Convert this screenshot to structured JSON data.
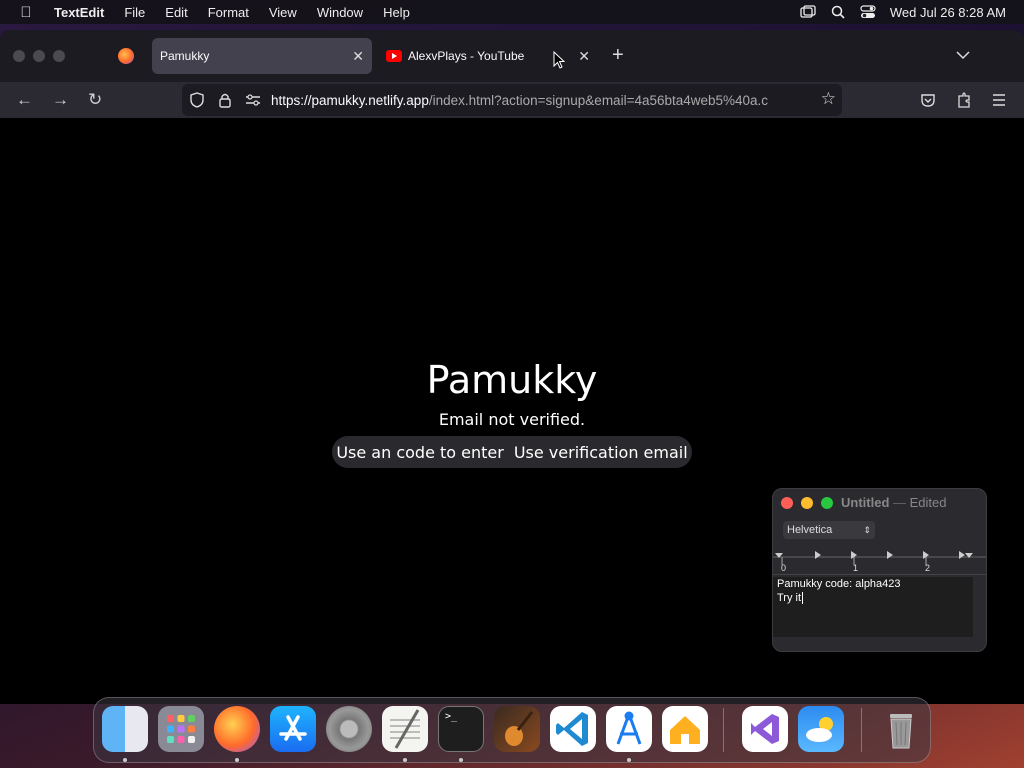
{
  "menubar": {
    "app_name": "TextEdit",
    "items": [
      "File",
      "Edit",
      "Format",
      "View",
      "Window",
      "Help"
    ],
    "clock": "Wed Jul 26  8:28 AM"
  },
  "browser": {
    "tabs": [
      {
        "title": "Pamukky",
        "active": true
      },
      {
        "title": "AlexvPlays - YouTube",
        "active": false
      }
    ],
    "url_host": "https://pamukky.netlify.app",
    "url_path": "/index.html?action=signup&email=4a56bta4web5%40a.c"
  },
  "page": {
    "title": "Pamukky",
    "subtitle": "Email not verified.",
    "code_button": "Use an code to enter",
    "email_button": "Use verification email"
  },
  "textedit": {
    "title": "Untitled",
    "status": "Edited",
    "font": "Helvetica",
    "ruler_marks": [
      "0",
      "1",
      "2"
    ],
    "lines": [
      "Pamukky code: alpha423",
      "Try it"
    ]
  },
  "dock": {
    "apps": [
      "Finder",
      "Launchpad",
      "Firefox",
      "App Store",
      "System Settings",
      "TextEdit",
      "Terminal",
      "GarageBand",
      "Visual Studio Code",
      "Xcode Instruments",
      "Home",
      "Visual Studio",
      "Weather",
      "Trash"
    ]
  }
}
